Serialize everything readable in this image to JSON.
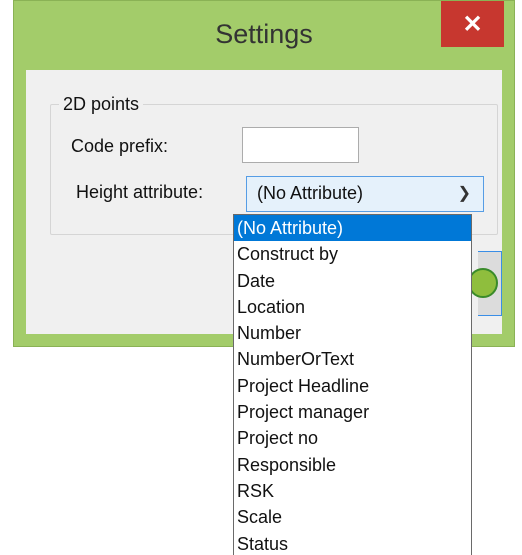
{
  "dialog": {
    "title": "Settings",
    "close_icon": "close-icon",
    "group_label": "2D points",
    "code_prefix_label": "Code prefix:",
    "code_prefix_value": "",
    "height_attribute_label": "Height attribute:",
    "height_attribute_value": "(No Attribute)",
    "accent_color": "#a3cc6a",
    "close_color": "#c7372f"
  },
  "dropdown": {
    "items": [
      "(No Attribute)",
      "Construct by",
      "Date",
      "Location",
      "Number",
      "NumberOrText",
      "Project Headline",
      "Project manager",
      "Project no",
      "Responsible",
      "RSK",
      "Scale",
      "Status"
    ],
    "selected_index": 0
  }
}
